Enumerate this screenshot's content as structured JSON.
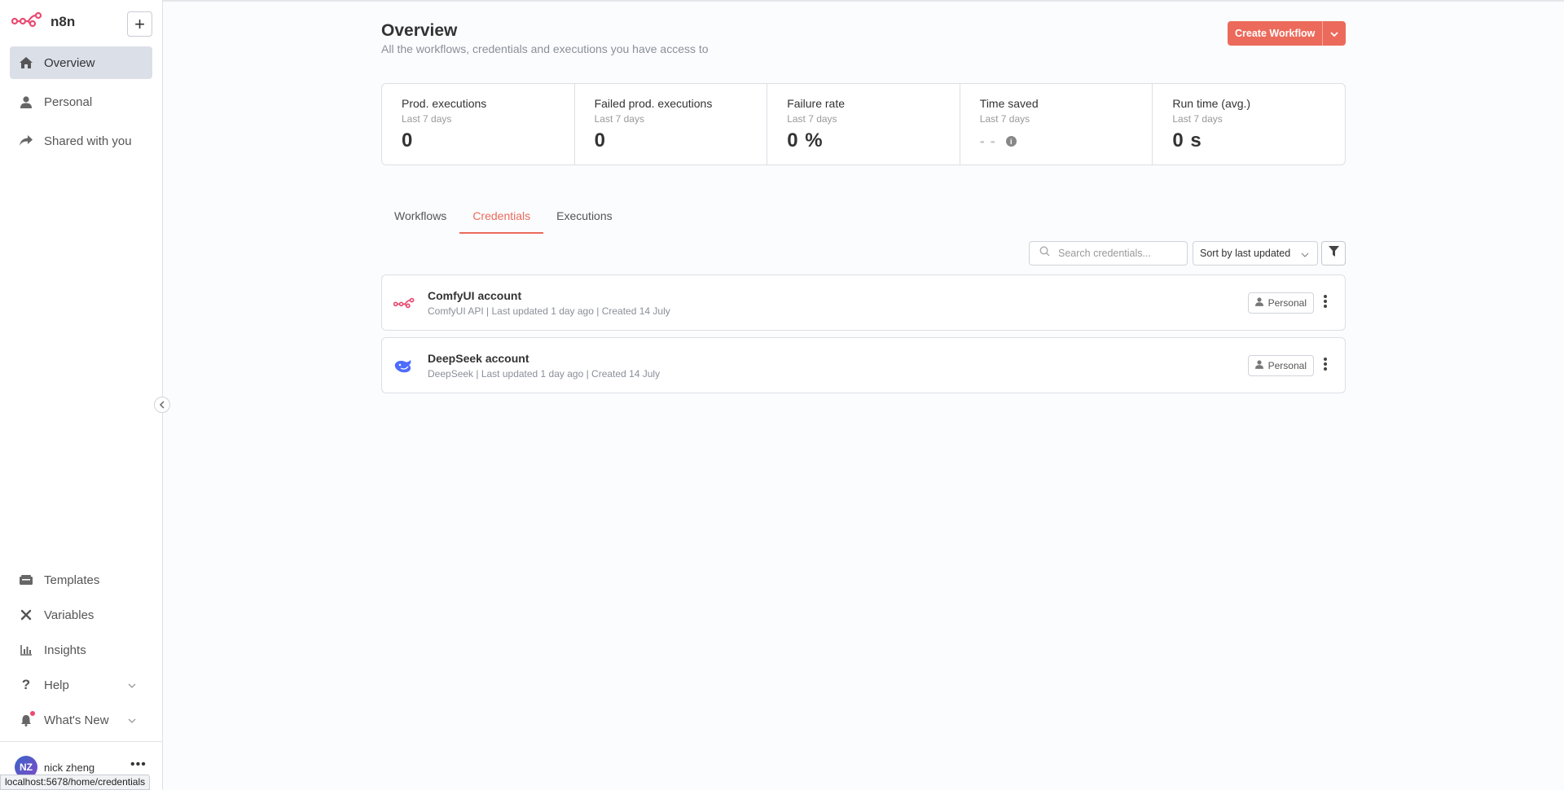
{
  "sidebar": {
    "brand": "n8n",
    "add_button": "+",
    "nav": [
      {
        "label": "Overview",
        "icon": "home-icon"
      },
      {
        "label": "Personal",
        "icon": "user-icon"
      },
      {
        "label": "Shared with you",
        "icon": "share-icon"
      }
    ],
    "bottom_nav": [
      {
        "label": "Templates",
        "icon": "templates-icon"
      },
      {
        "label": "Variables",
        "icon": "variables-icon"
      },
      {
        "label": "Insights",
        "icon": "insights-icon"
      },
      {
        "label": "Help",
        "icon": "help-icon"
      },
      {
        "label": "What's New",
        "icon": "bell-icon"
      }
    ],
    "user": {
      "initials": "NZ",
      "name": "nick zheng"
    },
    "user_menu": "•••"
  },
  "header": {
    "title": "Overview",
    "subtitle": "All the workflows, credentials and executions you have access to",
    "create_button": "Create Workflow"
  },
  "stats": [
    {
      "label": "Prod. executions",
      "period": "Last 7 days",
      "value": "0"
    },
    {
      "label": "Failed prod. executions",
      "period": "Last 7 days",
      "value": "0"
    },
    {
      "label": "Failure rate",
      "period": "Last 7 days",
      "value": "0 %"
    },
    {
      "label": "Time saved",
      "period": "Last 7 days",
      "value": "- -"
    },
    {
      "label": "Run time (avg.)",
      "period": "Last 7 days",
      "value": "0 s"
    }
  ],
  "tabs": [
    {
      "label": "Workflows",
      "active": false
    },
    {
      "label": "Credentials",
      "active": true
    },
    {
      "label": "Executions",
      "active": false
    }
  ],
  "toolbar": {
    "search_placeholder": "Search credentials...",
    "sort_value": "Sort by last updated"
  },
  "credentials": [
    {
      "name": "ComfyUI account",
      "meta": "ComfyUI API | Last updated 1 day ago | Created 14 July",
      "badge": "Personal",
      "icon": "comfyui-icon"
    },
    {
      "name": "DeepSeek account",
      "meta": "DeepSeek | Last updated 1 day ago | Created 14 July",
      "badge": "Personal",
      "icon": "deepseek-icon"
    }
  ],
  "status_url": "localhost:5678/home/credentials",
  "colors": {
    "accent": "#ec6a5b",
    "brand": "#ea4b71",
    "deepseek": "#4d6bfe"
  }
}
